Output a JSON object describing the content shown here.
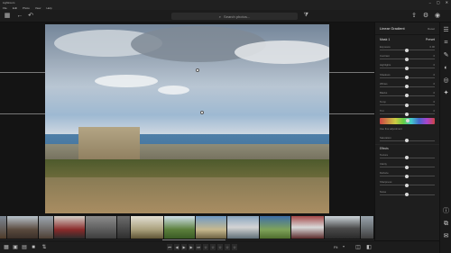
{
  "app": {
    "title": "Lightroom",
    "menu": [
      "File",
      "Edit",
      "Photo",
      "View",
      "Help"
    ]
  },
  "toolbar": {
    "search_placeholder": "Search photos...",
    "left_icons": [
      "grid-icon",
      "back-icon",
      "undo-icon",
      "redo-icon"
    ],
    "right_icons": [
      "share-icon",
      "adjust-icon",
      "help-icon",
      "account-icon"
    ]
  },
  "panel": {
    "title": "Linear Gradient",
    "reset_label": "Reset",
    "mask_name": "Mask 1",
    "mask_action": "Preset",
    "sliders": [
      {
        "label": "Exposure",
        "value": "0.00"
      },
      {
        "label": "Contrast",
        "value": "0"
      },
      {
        "label": "Highlights",
        "value": "0"
      },
      {
        "label": "Shadows",
        "value": "0"
      },
      {
        "label": "Whites",
        "value": "0"
      },
      {
        "label": "Blacks",
        "value": "0"
      },
      {
        "label": "Temp",
        "value": "0"
      },
      {
        "label": "Tint",
        "value": "0"
      },
      {
        "label": "Hue",
        "value": "0"
      }
    ],
    "hue_check_label": "Use fine adjustment",
    "section_saturation": "Saturation",
    "effects_title": "Effects",
    "effects_sliders": [
      {
        "label": "Texture",
        "value": "0"
      },
      {
        "label": "Clarity",
        "value": "0"
      },
      {
        "label": "Dehaze",
        "value": "0"
      },
      {
        "label": "Sharpness",
        "value": "0"
      },
      {
        "label": "Noise",
        "value": "0"
      }
    ]
  },
  "bottom": {
    "zoom_label": "Fit",
    "page_indicator": "1 / 1"
  },
  "filmstrip": {
    "count": 12
  },
  "colors": {
    "accent": "#4a90d9",
    "panel_bg": "#1e1e1e",
    "canvas_bg": "#141414"
  }
}
